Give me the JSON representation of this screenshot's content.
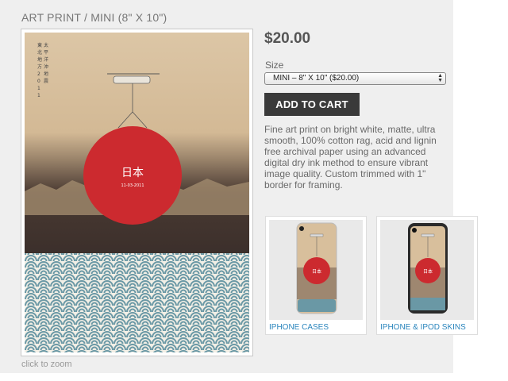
{
  "product": {
    "title": "ART PRINT / MINI (8\" X 10\")",
    "price": "$20.00",
    "size_label": "Size",
    "size_selected": "MINI – 8\" X 10\" ($20.00)",
    "add_to_cart": "ADD TO CART",
    "description": "Fine art print on bright white, matte, ultra smooth, 100% cotton rag, acid and lignin free archival paper using an advanced digital dry ink method to ensure vibrant image quality. Custom trimmed with 1\" border for framing.",
    "zoom_hint": "click to zoom"
  },
  "artwork": {
    "kanji_main": "日本",
    "date": "11-03-2011",
    "vertical_text": [
      "太",
      "平",
      "洋",
      "沖",
      "地",
      "震"
    ],
    "vertical_text_2": [
      "東",
      "北",
      "地",
      "方",
      "2",
      "0",
      "1",
      "1"
    ],
    "colors": {
      "paper": "#d9c1a2",
      "sun": "#cc2a2f",
      "waves": "#5e8e9b",
      "mountains": "#a89476"
    }
  },
  "related": [
    {
      "label": "IPHONE CASES",
      "kanji": "日本"
    },
    {
      "label": "IPHONE & IPOD SKINS",
      "kanji": "日本"
    }
  ]
}
